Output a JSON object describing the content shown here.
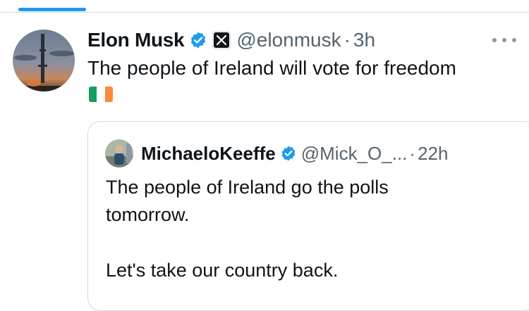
{
  "tweet": {
    "author_name": "Elon Musk",
    "handle": "@elonmusk",
    "separator": "·",
    "time": "3h",
    "text": "The people of Ireland will vote for freedom",
    "flag_emoji": "irish-flag",
    "flag_colors": [
      "#169b62",
      "#ffffff",
      "#ff883e"
    ]
  },
  "quoted": {
    "author_name": "MichaeloKeeffe",
    "handle": "@Mick_O_...",
    "separator": "·",
    "time": "22h",
    "text": "The people of Ireland go the polls tomorrow.",
    "text_line2": "Let's take our country back."
  },
  "colors": {
    "accent": "#1d9bf0",
    "secondary_text": "#536471",
    "border": "#cfd9de"
  }
}
